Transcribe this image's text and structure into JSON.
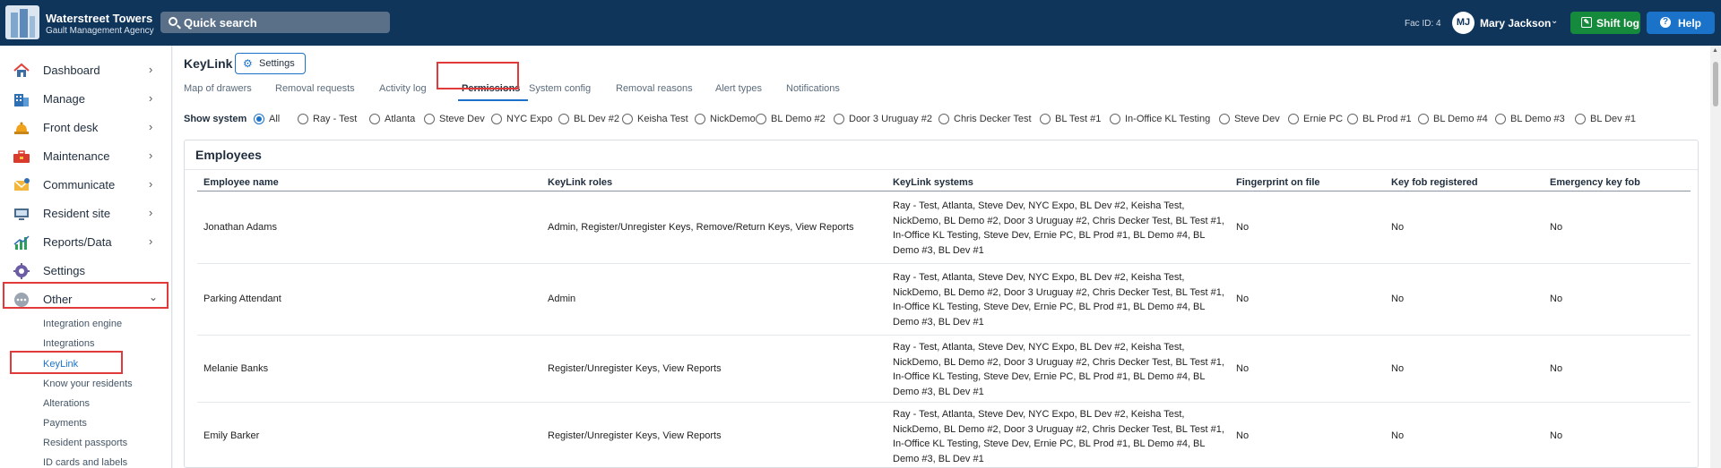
{
  "header": {
    "brand_name": "Waterstreet Towers",
    "brand_sub": "Gault Management Agency",
    "search_placeholder": "Quick search",
    "fac_id": "Fac ID: 4",
    "avatar_initials": "MJ",
    "user_name": "Mary Jackson",
    "shift_log_label": "Shift log",
    "help_label": "Help"
  },
  "sidebar": {
    "items": [
      {
        "label": "Dashboard",
        "icon": "home-icon"
      },
      {
        "label": "Manage",
        "icon": "building-icon"
      },
      {
        "label": "Front desk",
        "icon": "bell-icon"
      },
      {
        "label": "Maintenance",
        "icon": "toolbox-icon"
      },
      {
        "label": "Communicate",
        "icon": "envelope-icon"
      },
      {
        "label": "Resident site",
        "icon": "monitor-icon"
      },
      {
        "label": "Reports/Data",
        "icon": "chart-icon"
      },
      {
        "label": "Settings",
        "icon": "gear-icon"
      },
      {
        "label": "Other",
        "icon": "more-icon"
      }
    ],
    "subitems": [
      "Integration engine",
      "Integrations",
      "KeyLink",
      "Know your residents",
      "Alterations",
      "Payments",
      "Resident passports",
      "ID cards and labels"
    ]
  },
  "page": {
    "title": "KeyLink",
    "settings_label": "Settings",
    "tabs": [
      "Map of drawers",
      "Removal requests",
      "Activity log",
      "Permissions",
      "System config",
      "Removal reasons",
      "Alert types",
      "Notifications"
    ],
    "active_tab": "Permissions",
    "filter_label": "Show system",
    "systems": [
      "All",
      "Ray - Test",
      "Atlanta",
      "Steve Dev",
      "NYC Expo",
      "BL Dev #2",
      "Keisha Test",
      "NickDemo",
      "BL Demo #2",
      "Door 3 Uruguay #2",
      "Chris Decker Test",
      "BL Test #1",
      "In-Office KL Testing",
      "Steve Dev",
      "Ernie PC",
      "BL Prod #1",
      "BL Demo #4",
      "BL Demo #3",
      "BL Dev #1"
    ],
    "selected_system": "All"
  },
  "employees": {
    "title": "Employees",
    "columns": [
      "Employee name",
      "KeyLink roles",
      "KeyLink systems",
      "Fingerprint on file",
      "Key fob registered",
      "Emergency key fob"
    ],
    "rows": [
      {
        "name": "Jonathan Adams",
        "roles": "Admin, Register/Unregister Keys, Remove/Return Keys, View Reports",
        "systems": "Ray - Test, Atlanta, Steve Dev, NYC Expo, BL Dev #2, Keisha Test, NickDemo, BL Demo #2, Door 3 Uruguay #2, Chris Decker Test, BL Test #1, In-Office KL Testing, Steve Dev, Ernie PC, BL Prod #1, BL Demo #4, BL Demo #3, BL Dev #1",
        "fingerprint": "No",
        "keyfob": "No",
        "emergency": "No"
      },
      {
        "name": "Parking Attendant",
        "roles": "Admin",
        "systems": "Ray - Test, Atlanta, Steve Dev, NYC Expo, BL Dev #2, Keisha Test, NickDemo, BL Demo #2, Door 3 Uruguay #2, Chris Decker Test, BL Test #1, In-Office KL Testing, Steve Dev, Ernie PC, BL Prod #1, BL Demo #4, BL Demo #3, BL Dev #1",
        "fingerprint": "No",
        "keyfob": "No",
        "emergency": "No"
      },
      {
        "name": "Melanie Banks",
        "roles": "Register/Unregister Keys, View Reports",
        "systems": "Ray - Test, Atlanta, Steve Dev, NYC Expo, BL Dev #2, Keisha Test, NickDemo, BL Demo #2, Door 3 Uruguay #2, Chris Decker Test, BL Test #1, In-Office KL Testing, Steve Dev, Ernie PC, BL Prod #1, BL Demo #4, BL Demo #3, BL Dev #1",
        "fingerprint": "No",
        "keyfob": "No",
        "emergency": "No"
      },
      {
        "name": "Emily Barker",
        "roles": "Register/Unregister Keys, View Reports",
        "systems": "Ray - Test, Atlanta, Steve Dev, NYC Expo, BL Dev #2, Keisha Test, NickDemo, BL Demo #2, Door 3 Uruguay #2, Chris Decker Test, BL Test #1, In-Office KL Testing, Steve Dev, Ernie PC, BL Prod #1, BL Demo #4, BL Demo #3, BL Dev #1",
        "fingerprint": "No",
        "keyfob": "No",
        "emergency": "No"
      }
    ]
  },
  "colors": {
    "topbar": "#10355b",
    "accent": "#1a73c9",
    "shift_log": "#168a3c",
    "highlight": "#e03a3a"
  }
}
